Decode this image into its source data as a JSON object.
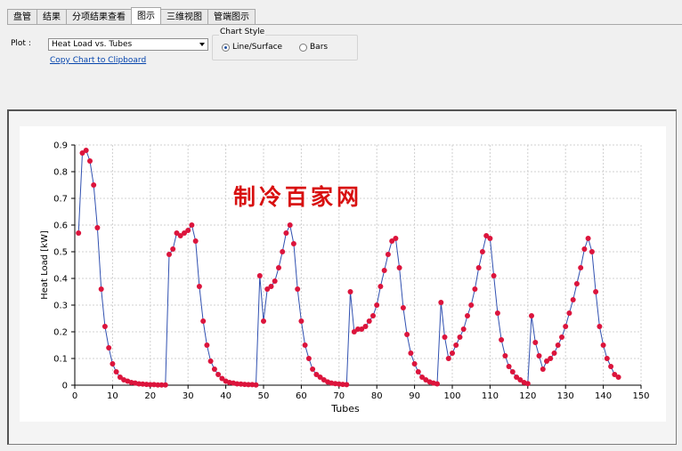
{
  "tabs": [
    {
      "label": "盘管"
    },
    {
      "label": "结果"
    },
    {
      "label": "分项结果查看"
    },
    {
      "label": "图示",
      "active": true
    },
    {
      "label": "三维视图"
    },
    {
      "label": "管端图示"
    }
  ],
  "controls": {
    "plot_label": "Plot :",
    "plot_selected": "Heat Load vs. Tubes",
    "copy_link": "Copy Chart to Clipboard",
    "chart_style_title": "Chart Style",
    "radio_line": "Line/Surface",
    "radio_bars": "Bars",
    "selected_style": "line"
  },
  "watermark": "制冷百家网",
  "chart_data": {
    "type": "line",
    "xlabel": "Tubes",
    "ylabel": "Heat Load [kW]",
    "xlim": [
      0,
      150
    ],
    "ylim": [
      0,
      0.9
    ],
    "xticks": [
      0,
      10,
      20,
      30,
      40,
      50,
      60,
      70,
      80,
      90,
      100,
      110,
      120,
      130,
      140,
      150
    ],
    "yticks": [
      0,
      0.1,
      0.2,
      0.3,
      0.4,
      0.5,
      0.6,
      0.7,
      0.8,
      0.9
    ],
    "grid": true,
    "line_color": "#3050b0",
    "marker_color": "#dc143c",
    "points": [
      [
        1,
        0.57
      ],
      [
        2,
        0.87
      ],
      [
        3,
        0.88
      ],
      [
        4,
        0.84
      ],
      [
        5,
        0.75
      ],
      [
        6,
        0.59
      ],
      [
        7,
        0.36
      ],
      [
        8,
        0.22
      ],
      [
        9,
        0.14
      ],
      [
        10,
        0.08
      ],
      [
        11,
        0.05
      ],
      [
        12,
        0.03
      ],
      [
        13,
        0.02
      ],
      [
        14,
        0.015
      ],
      [
        15,
        0.01
      ],
      [
        16,
        0.008
      ],
      [
        17,
        0.005
      ],
      [
        18,
        0.004
      ],
      [
        19,
        0.003
      ],
      [
        20,
        0.002
      ],
      [
        21,
        0.002
      ],
      [
        22,
        0.001
      ],
      [
        23,
        0.001
      ],
      [
        24,
        0.001
      ],
      [
        25,
        0.49
      ],
      [
        26,
        0.51
      ],
      [
        27,
        0.57
      ],
      [
        28,
        0.56
      ],
      [
        29,
        0.57
      ],
      [
        30,
        0.58
      ],
      [
        31,
        0.6
      ],
      [
        32,
        0.54
      ],
      [
        33,
        0.37
      ],
      [
        34,
        0.24
      ],
      [
        35,
        0.15
      ],
      [
        36,
        0.09
      ],
      [
        37,
        0.06
      ],
      [
        38,
        0.04
      ],
      [
        39,
        0.025
      ],
      [
        40,
        0.015
      ],
      [
        41,
        0.01
      ],
      [
        42,
        0.008
      ],
      [
        43,
        0.005
      ],
      [
        44,
        0.004
      ],
      [
        45,
        0.003
      ],
      [
        46,
        0.002
      ],
      [
        47,
        0.002
      ],
      [
        48,
        0.001
      ],
      [
        49,
        0.41
      ],
      [
        50,
        0.24
      ],
      [
        51,
        0.36
      ],
      [
        52,
        0.37
      ],
      [
        53,
        0.39
      ],
      [
        54,
        0.44
      ],
      [
        55,
        0.5
      ],
      [
        56,
        0.57
      ],
      [
        57,
        0.6
      ],
      [
        58,
        0.53
      ],
      [
        59,
        0.36
      ],
      [
        60,
        0.24
      ],
      [
        61,
        0.15
      ],
      [
        62,
        0.1
      ],
      [
        63,
        0.06
      ],
      [
        64,
        0.04
      ],
      [
        65,
        0.03
      ],
      [
        66,
        0.02
      ],
      [
        67,
        0.012
      ],
      [
        68,
        0.008
      ],
      [
        69,
        0.006
      ],
      [
        70,
        0.004
      ],
      [
        71,
        0.003
      ],
      [
        72,
        0.002
      ],
      [
        73,
        0.35
      ],
      [
        74,
        0.2
      ],
      [
        75,
        0.21
      ],
      [
        76,
        0.21
      ],
      [
        77,
        0.22
      ],
      [
        78,
        0.24
      ],
      [
        79,
        0.26
      ],
      [
        80,
        0.3
      ],
      [
        81,
        0.37
      ],
      [
        82,
        0.43
      ],
      [
        83,
        0.49
      ],
      [
        84,
        0.54
      ],
      [
        85,
        0.55
      ],
      [
        86,
        0.44
      ],
      [
        87,
        0.29
      ],
      [
        88,
        0.19
      ],
      [
        89,
        0.12
      ],
      [
        90,
        0.08
      ],
      [
        91,
        0.05
      ],
      [
        92,
        0.03
      ],
      [
        93,
        0.02
      ],
      [
        94,
        0.012
      ],
      [
        95,
        0.008
      ],
      [
        96,
        0.005
      ],
      [
        97,
        0.31
      ],
      [
        98,
        0.18
      ],
      [
        99,
        0.1
      ],
      [
        100,
        0.12
      ],
      [
        101,
        0.15
      ],
      [
        102,
        0.18
      ],
      [
        103,
        0.21
      ],
      [
        104,
        0.26
      ],
      [
        105,
        0.3
      ],
      [
        106,
        0.36
      ],
      [
        107,
        0.44
      ],
      [
        108,
        0.5
      ],
      [
        109,
        0.56
      ],
      [
        110,
        0.55
      ],
      [
        111,
        0.41
      ],
      [
        112,
        0.27
      ],
      [
        113,
        0.17
      ],
      [
        114,
        0.11
      ],
      [
        115,
        0.07
      ],
      [
        116,
        0.05
      ],
      [
        117,
        0.03
      ],
      [
        118,
        0.02
      ],
      [
        119,
        0.01
      ],
      [
        120,
        0.006
      ],
      [
        121,
        0.26
      ],
      [
        122,
        0.16
      ],
      [
        123,
        0.11
      ],
      [
        124,
        0.06
      ],
      [
        125,
        0.09
      ],
      [
        126,
        0.1
      ],
      [
        127,
        0.12
      ],
      [
        128,
        0.15
      ],
      [
        129,
        0.18
      ],
      [
        130,
        0.22
      ],
      [
        131,
        0.27
      ],
      [
        132,
        0.32
      ],
      [
        133,
        0.38
      ],
      [
        134,
        0.44
      ],
      [
        135,
        0.51
      ],
      [
        136,
        0.55
      ],
      [
        137,
        0.5
      ],
      [
        138,
        0.35
      ],
      [
        139,
        0.22
      ],
      [
        140,
        0.15
      ],
      [
        141,
        0.1
      ],
      [
        142,
        0.07
      ],
      [
        143,
        0.04
      ],
      [
        144,
        0.03
      ]
    ]
  }
}
